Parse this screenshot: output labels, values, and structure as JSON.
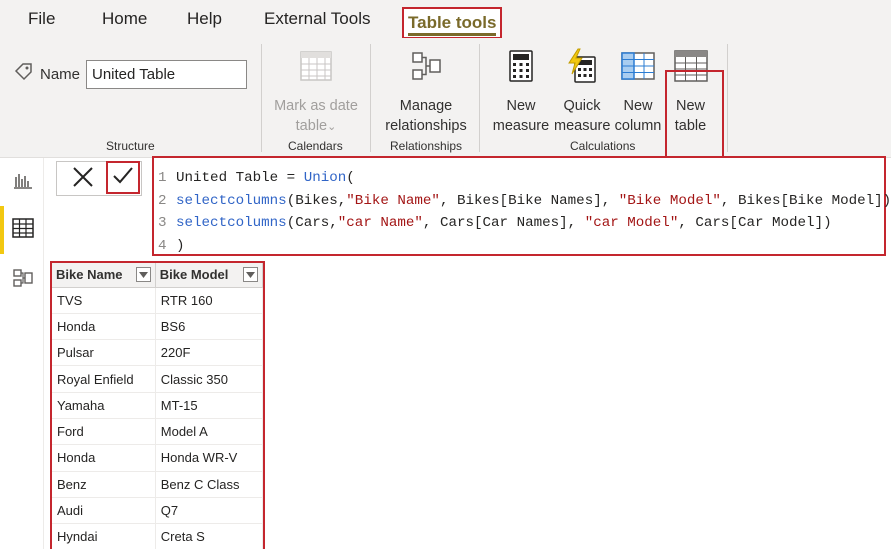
{
  "menu": {
    "tabs": [
      "File",
      "Home",
      "Help",
      "External Tools",
      "Table tools"
    ],
    "active_tab": "Table tools"
  },
  "ribbon": {
    "name_label": "Name",
    "name_value": "United Table",
    "buttons": {
      "mark_as_date_table": [
        "Mark as date",
        "table"
      ],
      "manage_relationships": [
        "Manage",
        "relationships"
      ],
      "new_measure": [
        "New",
        "measure"
      ],
      "quick_measure": [
        "Quick",
        "measure"
      ],
      "new_column": [
        "New",
        "column"
      ],
      "new_table": [
        "New",
        "table"
      ]
    },
    "mark_caret": "⌄",
    "groups": {
      "structure": "Structure",
      "calendars": "Calendars",
      "relationships": "Relationships",
      "calculations": "Calculations"
    }
  },
  "formula": {
    "cancel_icon": "close-icon",
    "commit_icon": "checkmark-icon",
    "lines": [
      {
        "num": "1",
        "segs": [
          {
            "t": "United Table = ",
            "c": ""
          },
          {
            "t": "Union",
            "c": "kw"
          },
          {
            "t": "(",
            "c": ""
          }
        ]
      },
      {
        "num": "2",
        "segs": [
          {
            "t": "selectcolumns",
            "c": "kw"
          },
          {
            "t": "(Bikes,",
            "c": ""
          },
          {
            "t": "\"Bike Name\"",
            "c": "str"
          },
          {
            "t": ", Bikes[Bike Names], ",
            "c": ""
          },
          {
            "t": "\"Bike Model\"",
            "c": "str"
          },
          {
            "t": ", Bikes[Bike Model]),",
            "c": ""
          }
        ]
      },
      {
        "num": "3",
        "segs": [
          {
            "t": "selectcolumns",
            "c": "kw"
          },
          {
            "t": "(Cars,",
            "c": ""
          },
          {
            "t": "\"car Name\"",
            "c": "str"
          },
          {
            "t": ", Cars[Car Names], ",
            "c": ""
          },
          {
            "t": "\"car Model\"",
            "c": "str"
          },
          {
            "t": ", Cars[Car Model])",
            "c": ""
          }
        ]
      },
      {
        "num": "4",
        "segs": [
          {
            "t": ")",
            "c": ""
          }
        ]
      }
    ]
  },
  "table": {
    "columns": [
      "Bike Name",
      "Bike Model"
    ],
    "rows": [
      [
        "TVS",
        "RTR 160"
      ],
      [
        "Honda",
        "BS6"
      ],
      [
        "Pulsar",
        "220F"
      ],
      [
        "Royal Enfield",
        "Classic 350"
      ],
      [
        "Yamaha",
        "MT-15"
      ],
      [
        "Ford",
        "Model A"
      ],
      [
        "Honda",
        "Honda WR-V"
      ],
      [
        "Benz",
        "Benz C Class"
      ],
      [
        "Audi",
        "Q7"
      ],
      [
        "Hyndai",
        "Creta S"
      ]
    ]
  },
  "left_rail": {
    "items": [
      "report-view-icon",
      "data-view-icon",
      "model-view-icon"
    ],
    "active": "data-view-icon"
  },
  "colors": {
    "highlight_border": "#c4262e",
    "active_tab_text": "#7a6a2a",
    "rail_accent": "#f2c811",
    "keyword": "#3165c7",
    "string": "#a31515"
  }
}
